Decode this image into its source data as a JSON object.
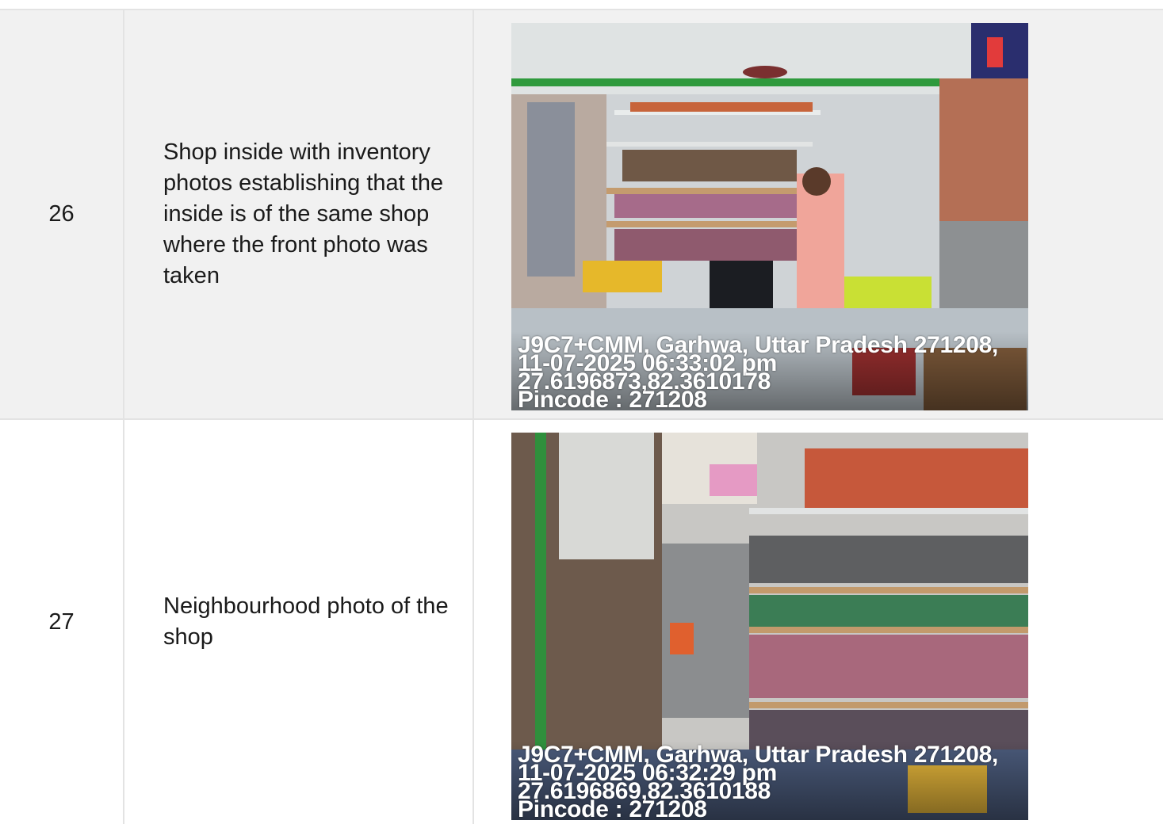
{
  "rows": [
    {
      "number": "26",
      "description": "Shop inside with inventory photos establishing that the inside is of the same shop where the front photo was taken",
      "photo": {
        "stamp_location": "J9C7+CMM, Garhwa, Uttar Pradesh 271208,",
        "stamp_datetime": "11-07-2025 06:33:02 pm",
        "stamp_coords": "27.6196873,82.3610178",
        "stamp_pincode": "Pincode : 271208"
      }
    },
    {
      "number": "27",
      "description": "Neighbourhood photo of the shop",
      "photo": {
        "stamp_location": "J9C7+CMM, Garhwa, Uttar Pradesh 271208,",
        "stamp_datetime": "11-07-2025 06:32:29 pm",
        "stamp_coords": "27.6196869,82.3610188",
        "stamp_pincode": "Pincode : 271208"
      }
    }
  ]
}
